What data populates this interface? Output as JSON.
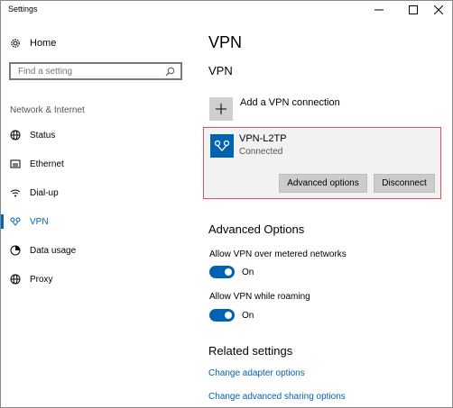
{
  "window": {
    "title": "Settings"
  },
  "sidebar": {
    "home_label": "Home",
    "search_placeholder": "Find a setting",
    "section": "Network & Internet",
    "items": [
      {
        "label": "Status",
        "icon": "globe-status-icon"
      },
      {
        "label": "Ethernet",
        "icon": "ethernet-icon"
      },
      {
        "label": "Dial-up",
        "icon": "dialup-icon"
      },
      {
        "label": "VPN",
        "icon": "vpn-icon",
        "active": true
      },
      {
        "label": "Data usage",
        "icon": "data-usage-icon"
      },
      {
        "label": "Proxy",
        "icon": "globe-icon"
      }
    ]
  },
  "main": {
    "title": "VPN",
    "vpn_heading": "VPN",
    "add_vpn_label": "Add a VPN connection",
    "connection": {
      "name": "VPN-L2TP",
      "status": "Connected",
      "advanced_button": "Advanced options",
      "disconnect_button": "Disconnect"
    },
    "advanced_heading": "Advanced Options",
    "options": [
      {
        "label": "Allow VPN over metered networks",
        "state": "On"
      },
      {
        "label": "Allow VPN while roaming",
        "state": "On"
      }
    ],
    "related_heading": "Related settings",
    "links": [
      "Change adapter options",
      "Change advanced sharing options"
    ]
  },
  "colors": {
    "accent": "#0063b1",
    "highlight_border": "#e0505a"
  }
}
